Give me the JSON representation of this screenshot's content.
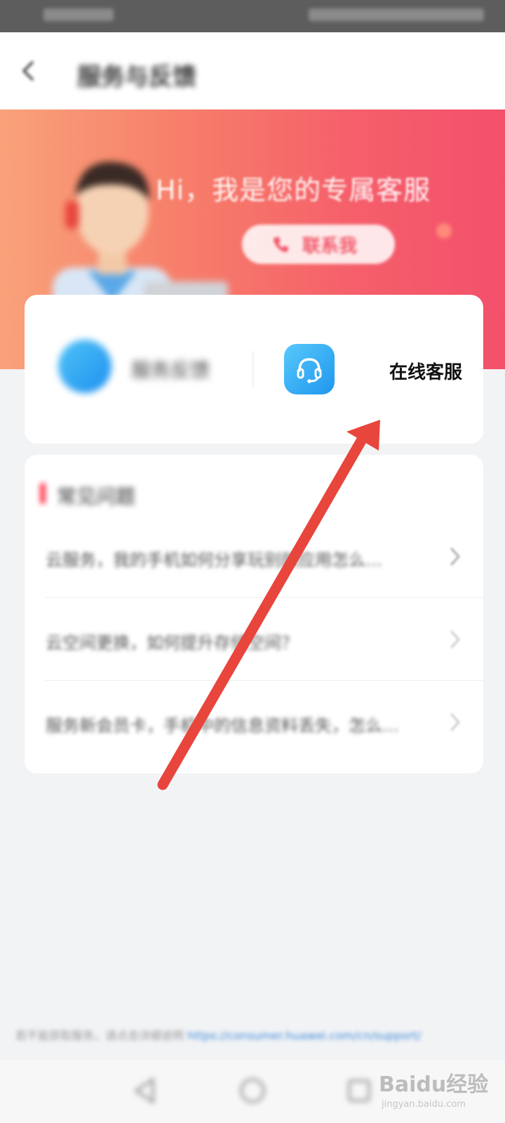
{
  "header": {
    "title": "服务与反馈"
  },
  "banner": {
    "greeting": "Hi，我是您的专属客服",
    "contact_label": "联系我"
  },
  "services": [
    {
      "label": "服务反馈",
      "icon": "edit-icon"
    },
    {
      "label": "在线客服",
      "icon": "headset-icon"
    }
  ],
  "faq": {
    "heading": "常见问题",
    "items": [
      "云服务，我的手机如何分享玩别的应用怎么…",
      "云空间更换，如何提升存储空间？",
      "服务新会员卡，手机中的信息资料丢失，怎么…"
    ]
  },
  "footer": {
    "note": "若不能获取服务，请点击详细说明",
    "link": "https://consumer.huawei.com/cn/support/"
  },
  "watermark": {
    "logo": "Baidu经验",
    "url": "jingyan.baidu.com"
  },
  "colors": {
    "accent": "#f5586a",
    "arrow": "#e8453c",
    "service_icon": "#1f96ee"
  }
}
